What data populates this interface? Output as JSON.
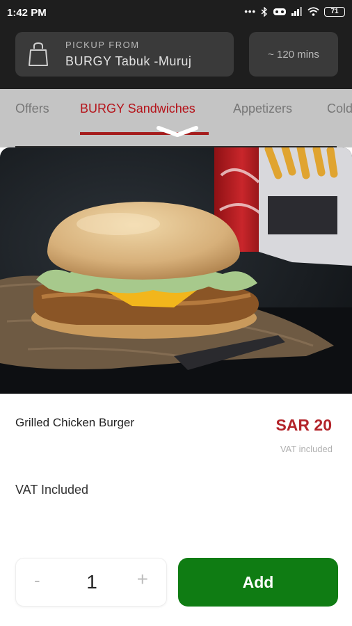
{
  "status_bar": {
    "time": "1:42 PM",
    "dots": "•••",
    "battery": "71"
  },
  "header": {
    "pickup_label": "PICKUP FROM",
    "store_name": "BURGY Tabuk -Muruj",
    "eta": "~ 120 mins"
  },
  "tabs": [
    {
      "label": "Offers"
    },
    {
      "label": "BURGY Sandwiches",
      "active": true
    },
    {
      "label": "Appetizers"
    },
    {
      "label": "Cold"
    }
  ],
  "product": {
    "name": "Grilled Chicken Burger",
    "price": "SAR 20",
    "price_note": "VAT included",
    "description": "VAT Included",
    "image_icon": "burger-photo"
  },
  "order": {
    "minus": "-",
    "quantity": "1",
    "plus": "+",
    "add_label": "Add"
  },
  "colors": {
    "accent_red": "#b3242a",
    "add_green": "#0f7c13",
    "header_bg": "#1e1e1e"
  }
}
